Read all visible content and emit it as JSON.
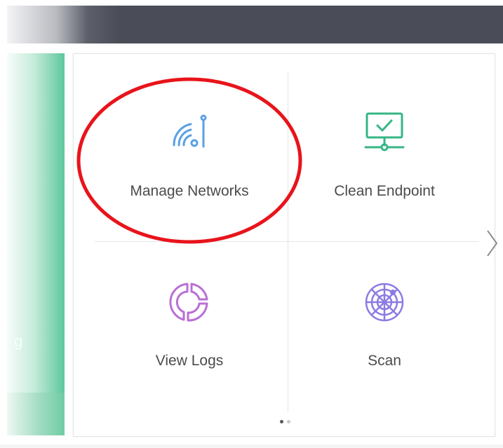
{
  "tiles": {
    "manage_networks": {
      "label": "Manage Networks",
      "icon": "wifi-antenna-icon",
      "color": "#5aa0e6"
    },
    "clean_endpoint": {
      "label": "Clean Endpoint",
      "icon": "monitor-check-icon",
      "color": "#35b685"
    },
    "view_logs": {
      "label": "View Logs",
      "icon": "donut-chart-icon",
      "color": "#b96fd6"
    },
    "scan": {
      "label": "Scan",
      "icon": "radar-icon",
      "color": "#8c7be3"
    }
  },
  "side_panel": {
    "letter": "g"
  },
  "pagination": {
    "current": 1,
    "total": 2
  },
  "colors": {
    "highlight": "#e8141b",
    "topbar": "#4a4d57",
    "side_accent": "#5ec79c"
  }
}
